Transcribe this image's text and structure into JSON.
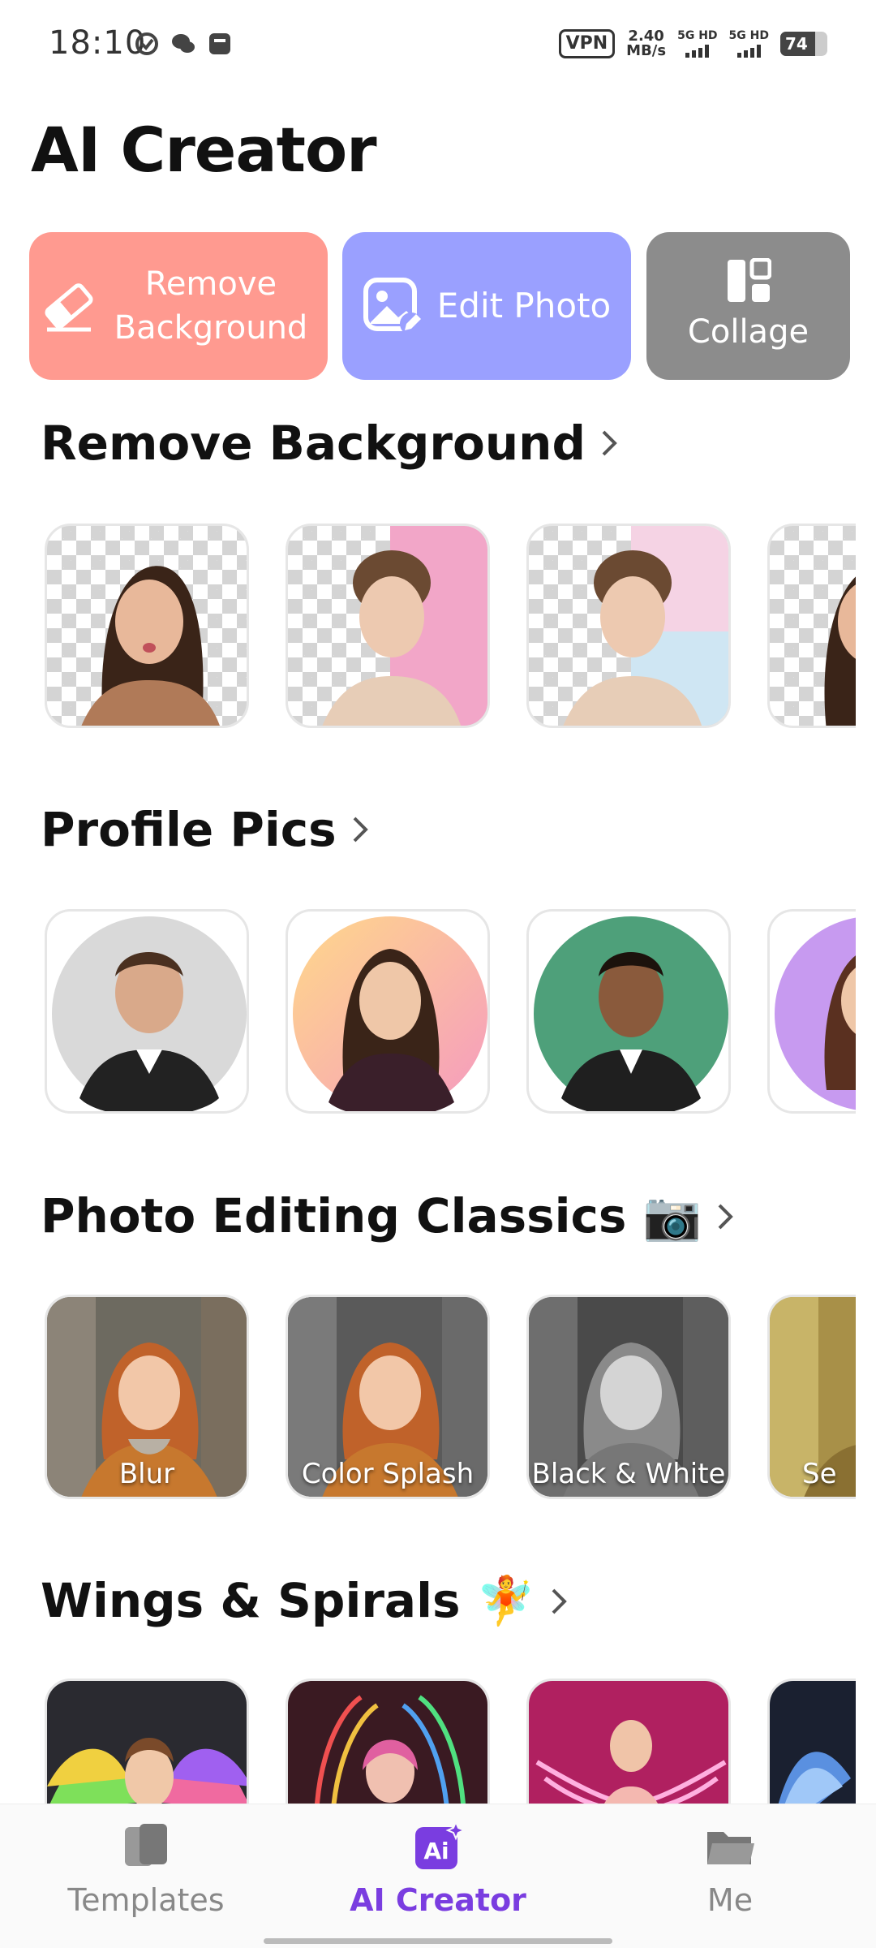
{
  "status_bar": {
    "time": "18:10",
    "vpn": "VPN",
    "speed_value": "2.40",
    "speed_unit": "MB/s",
    "net1": "5G HD",
    "net2": "5G HD",
    "battery": "74",
    "battery_level": 0.74
  },
  "page": {
    "title": "AI Creator"
  },
  "actions": {
    "remove_background": "Remove Background",
    "edit_photo": "Edit Photo",
    "collage": "Collage",
    "colors": {
      "remove": "#ff9a90",
      "edit": "#9aa0ff",
      "collage": "#8c8c8c"
    }
  },
  "sections": {
    "remove_background": {
      "title": "Remove Background"
    },
    "profile_pics": {
      "title": "Profile Pics"
    },
    "photo_editing": {
      "title": "Photo Editing Classics 📷",
      "tiles": [
        "Blur",
        "Color Splash",
        "Black & White",
        "Se"
      ]
    },
    "wings_spirals": {
      "title": "Wings & Spirals 🧚"
    }
  },
  "nav": {
    "templates": "Templates",
    "ai_creator": "AI Creator",
    "me": "Me",
    "active_color": "#7a3de0"
  }
}
